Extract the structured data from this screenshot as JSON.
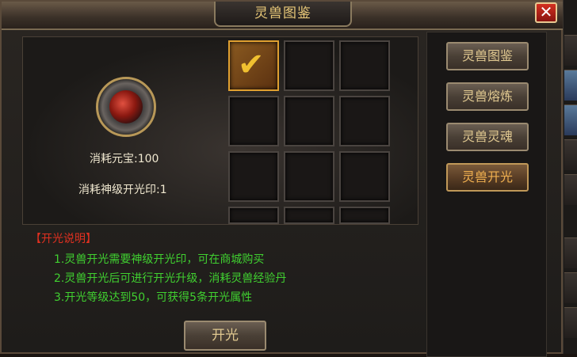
{
  "window": {
    "title": "灵兽图鉴",
    "close_label": "✕"
  },
  "pet": {
    "cost_gold": "消耗元宝:100",
    "cost_seal": "消耗神级开光印:1"
  },
  "grid": {
    "rows": 4,
    "cols": 3,
    "selected_index": 0
  },
  "side_menu": {
    "items": [
      {
        "label": "灵兽图鉴",
        "active": false
      },
      {
        "label": "灵兽熔炼",
        "active": false
      },
      {
        "label": "灵兽灵魂",
        "active": false
      },
      {
        "label": "灵兽开光",
        "active": true
      }
    ]
  },
  "description": {
    "title": "【开光说明】",
    "lines": [
      "1.灵兽开光需要神级开光印，可在商城购买",
      "2.灵兽开光后可进行开光升级，消耗灵兽经验丹",
      "3.开光等级达到50，可获得5条开光属性"
    ]
  },
  "action": {
    "label": "开光"
  },
  "colors": {
    "title_gold": "#e8c878",
    "desc_title_red": "#e03020",
    "desc_green": "#40d030",
    "selected_orange": "#e0a030"
  }
}
